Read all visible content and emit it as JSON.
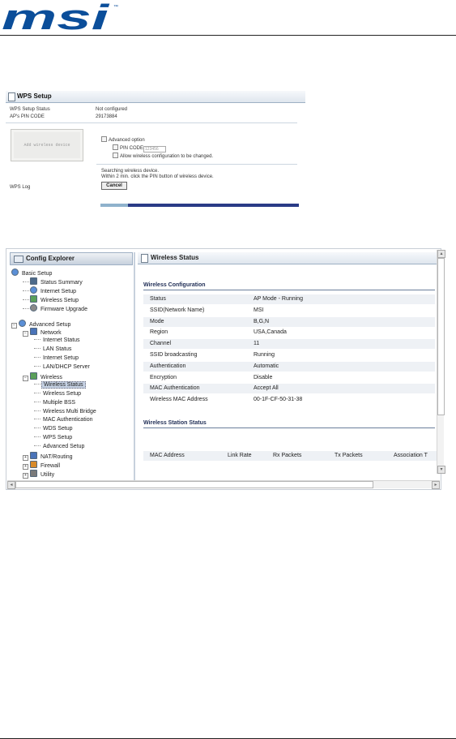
{
  "brand": {
    "logo_text": "msi",
    "trademark": "™"
  },
  "wps": {
    "title": "WPS Setup",
    "rows": [
      {
        "label": "WPS Setup Status",
        "value": "Not configured"
      },
      {
        "label": "AP's PIN CODE",
        "value": "29173884"
      }
    ],
    "add_button": "Add wireless device",
    "advanced_option": "Advanced option",
    "pin_code_label": "PIN CODE",
    "pin_code_value": "123456",
    "allow_change": "Allow wireless configuration to be changed.",
    "searching": "Searching wireless device.",
    "instruction": "Within 2 min. click the PIN button of wireless device.",
    "cancel": "Cancel",
    "log_label": "WPS Log",
    "progress_fraction": 0.14
  },
  "explorer": {
    "title": "Config Explorer",
    "tree": [
      {
        "id": "basic-setup",
        "label": "Basic Setup",
        "level": 0,
        "icon": "globe"
      },
      {
        "id": "status-summary",
        "label": "Status Summary",
        "level": 1,
        "icon": "monitor"
      },
      {
        "id": "internet-setup",
        "label": "Internet Setup",
        "level": 1,
        "icon": "globe"
      },
      {
        "id": "wireless-setup",
        "label": "Wireless Setup",
        "level": 1,
        "icon": "wireless"
      },
      {
        "id": "firmware-upgrade",
        "label": "Firmware Upgrade",
        "level": 1,
        "icon": "gear"
      },
      {
        "id": "advanced-setup",
        "label": "Advanced Setup",
        "level": 0,
        "icon": "globe",
        "toggle": "−"
      },
      {
        "id": "network",
        "label": "Network",
        "level": 1,
        "icon": "network",
        "toggle": "−"
      },
      {
        "id": "internet-status",
        "label": "Internet Status",
        "level": 2
      },
      {
        "id": "lan-status",
        "label": "LAN Status",
        "level": 2
      },
      {
        "id": "internet-setup-2",
        "label": "Internet Setup",
        "level": 2
      },
      {
        "id": "lan-dhcp-server",
        "label": "LAN/DHCP Server",
        "level": 2
      },
      {
        "id": "wireless",
        "label": "Wireless",
        "level": 1,
        "icon": "wireless",
        "toggle": "−"
      },
      {
        "id": "wireless-status",
        "label": "Wireless Status",
        "level": 2,
        "selected": true
      },
      {
        "id": "wireless-setup-2",
        "label": "Wireless Setup",
        "level": 2
      },
      {
        "id": "multiple-bss",
        "label": "Multiple BSS",
        "level": 2
      },
      {
        "id": "wireless-multi-bridge",
        "label": "Wireless Multi Bridge",
        "level": 2
      },
      {
        "id": "mac-authentication",
        "label": "MAC Authentication",
        "level": 2
      },
      {
        "id": "wds-setup",
        "label": "WDS Setup",
        "level": 2
      },
      {
        "id": "wps-setup",
        "label": "WPS Setup",
        "level": 2
      },
      {
        "id": "advanced-setup-2",
        "label": "Advanced Setup",
        "level": 2
      },
      {
        "id": "nat-routing",
        "label": "NAT/Routing",
        "level": 1,
        "icon": "network",
        "toggle": "+"
      },
      {
        "id": "firewall",
        "label": "Firewall",
        "level": 1,
        "icon": "firewall",
        "toggle": "+"
      },
      {
        "id": "utility",
        "label": "Utility",
        "level": 1,
        "icon": "tools",
        "toggle": "+"
      }
    ]
  },
  "wireless_status": {
    "title": "Wireless Status",
    "config_heading": "Wireless Configuration",
    "config": [
      {
        "label": "Status",
        "value": "AP Mode - Running"
      },
      {
        "label": "SSID(Network Name)",
        "value": "MSI"
      },
      {
        "label": "Mode",
        "value": "B,G,N"
      },
      {
        "label": "Region",
        "value": "USA,Canada"
      },
      {
        "label": "Channel",
        "value": "11"
      },
      {
        "label": "SSID broadcasting",
        "value": "Running"
      },
      {
        "label": "Authentication",
        "value": "Automatic"
      },
      {
        "label": "Encryption",
        "value": "Disable"
      },
      {
        "label": "MAC Authentication",
        "value": "Accept All"
      },
      {
        "label": "Wireless MAC Address",
        "value": "00-1F-CF-50-31-38"
      }
    ],
    "station_heading": "Wireless Station Status",
    "station_columns": [
      "MAC Address",
      "Link Rate",
      "Rx Packets",
      "Tx Packets",
      "Association T"
    ]
  },
  "colors": {
    "header_gradient_top": "#f6f8fb",
    "header_gradient_bottom": "#dfe6ee",
    "row_shade": "#eef1f5",
    "progress": "#2a3b86",
    "selection": "#c6d2e4",
    "logo": "#0b4e9a"
  }
}
